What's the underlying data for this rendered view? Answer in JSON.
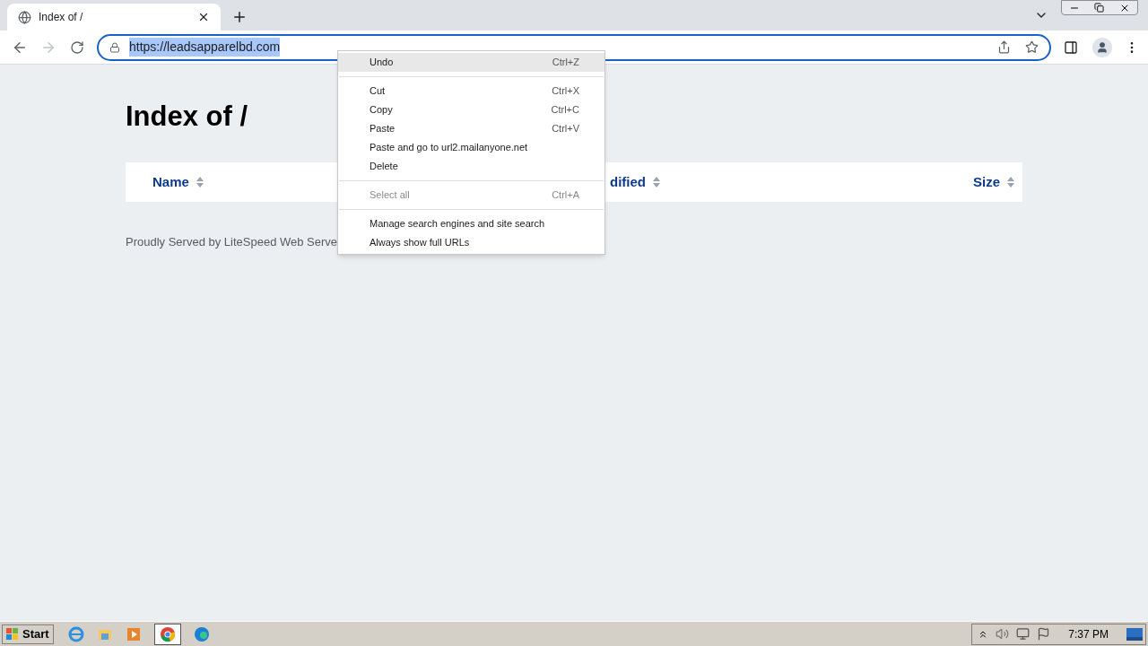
{
  "browser": {
    "tab": {
      "title": "Index of /"
    },
    "address": {
      "value": "https://leadsapparelbd.com",
      "selected": true
    }
  },
  "page": {
    "title": "Index of /",
    "columns": [
      {
        "label": "Name"
      },
      {
        "label": "dified"
      },
      {
        "label": "Size"
      }
    ],
    "footer": "Proudly Served by LiteSpeed Web Serve"
  },
  "context_menu": [
    {
      "kind": "item",
      "label": "Undo",
      "shortcut": "Ctrl+Z",
      "highlighted": true,
      "disabled": false
    },
    {
      "kind": "separator"
    },
    {
      "kind": "item",
      "label": "Cut",
      "shortcut": "Ctrl+X",
      "highlighted": false,
      "disabled": false
    },
    {
      "kind": "item",
      "label": "Copy",
      "shortcut": "Ctrl+C",
      "highlighted": false,
      "disabled": false
    },
    {
      "kind": "item",
      "label": "Paste",
      "shortcut": "Ctrl+V",
      "highlighted": false,
      "disabled": false
    },
    {
      "kind": "item",
      "label": "Paste and go to url2.mailanyone.net",
      "highlighted": false,
      "disabled": false
    },
    {
      "kind": "item",
      "label": "Delete",
      "highlighted": false,
      "disabled": false
    },
    {
      "kind": "separator"
    },
    {
      "kind": "item",
      "label": "Select all",
      "shortcut": "Ctrl+A",
      "highlighted": false,
      "disabled": true
    },
    {
      "kind": "separator"
    },
    {
      "kind": "item",
      "label": "Manage search engines and site search",
      "highlighted": false,
      "disabled": false
    },
    {
      "kind": "item",
      "label": "Always show full URLs",
      "highlighted": false,
      "disabled": false
    }
  ],
  "taskbar": {
    "start": "Start",
    "clock": "7:37 PM"
  }
}
